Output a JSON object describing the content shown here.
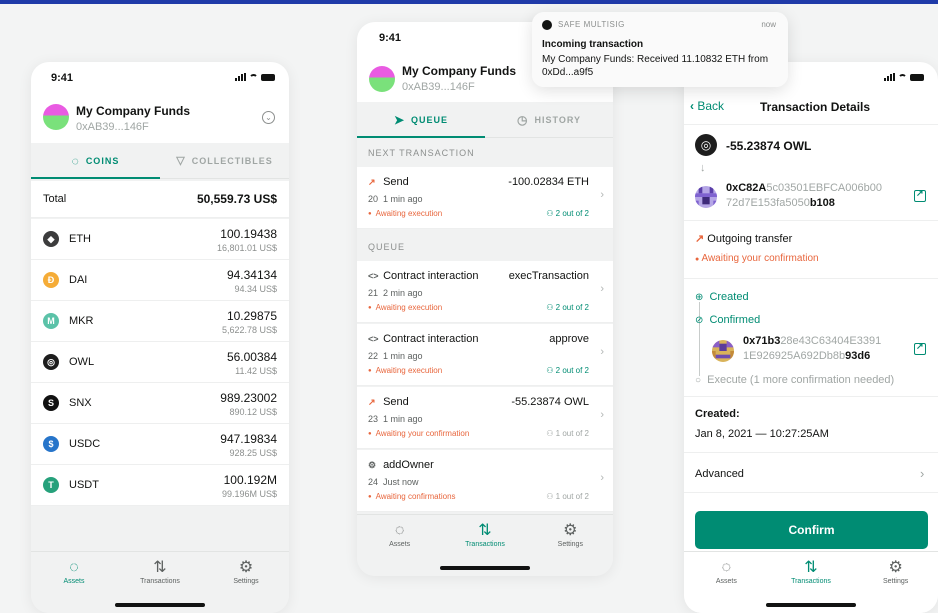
{
  "colors": {
    "primary": "#008c73",
    "warning": "#e8663d",
    "text": "#121312",
    "muted": "#a0a6a4"
  },
  "phone1": {
    "time": "9:41",
    "safe_name": "My Company Funds",
    "safe_address": "0xAB39...146F",
    "tabs": {
      "coins": "COINS",
      "collectibles": "COLLECTIBLES"
    },
    "total_label": "Total",
    "total_value": "50,559.73 US$",
    "coins": [
      {
        "symbol": "ETH",
        "balance": "100.19438",
        "fiat": "16,801.01 US$",
        "icon": "ethereum-icon",
        "color": "#3c3c3d",
        "glyph": "◆"
      },
      {
        "symbol": "DAI",
        "balance": "94.34134",
        "fiat": "94.34 US$",
        "icon": "dai-icon",
        "color": "#f5ac37",
        "glyph": "Ð"
      },
      {
        "symbol": "MKR",
        "balance": "10.29875",
        "fiat": "5,622.78 US$",
        "icon": "maker-icon",
        "color": "#5bc2a8",
        "glyph": "M"
      },
      {
        "symbol": "OWL",
        "balance": "56.00384",
        "fiat": "11.42 US$",
        "icon": "owl-icon",
        "color": "#1d1d1d",
        "glyph": "◎"
      },
      {
        "symbol": "SNX",
        "balance": "989.23002",
        "fiat": "890.12 US$",
        "icon": "synthetix-icon",
        "color": "#111111",
        "glyph": "S"
      },
      {
        "symbol": "USDC",
        "balance": "947.19834",
        "fiat": "928.25 US$",
        "icon": "usdc-icon",
        "color": "#2775ca",
        "glyph": "$"
      },
      {
        "symbol": "USDT",
        "balance": "100.192M",
        "fiat": "99.196M US$",
        "icon": "tether-icon",
        "color": "#26a17b",
        "glyph": "T"
      }
    ]
  },
  "nav": {
    "assets": "Assets",
    "transactions": "Transactions",
    "settings": "Settings"
  },
  "phone2": {
    "time": "9:41",
    "safe_name": "My Company Funds",
    "safe_address": "0xAB39...146F",
    "tabs": {
      "queue": "QUEUE",
      "history": "HISTORY"
    },
    "next_label": "NEXT TRANSACTION",
    "queue_label": "QUEUE",
    "next": {
      "title": "Send",
      "value": "-100.02834 ETH",
      "nonce": "20",
      "time": "1 min ago",
      "status": "Awaiting execution",
      "confirmations": "2 out of 2",
      "icon": "send"
    },
    "queue": [
      {
        "title": "Contract interaction",
        "value": "execTransaction",
        "nonce": "21",
        "time": "2 min ago",
        "status": "Awaiting execution",
        "confirmations": "2 out of 2",
        "icon": "code",
        "complete": true
      },
      {
        "title": "Contract interaction",
        "value": "approve",
        "nonce": "22",
        "time": "1 min ago",
        "status": "Awaiting execution",
        "confirmations": "2 out of 2",
        "icon": "code",
        "complete": true
      },
      {
        "title": "Send",
        "value": "-55.23874 OWL",
        "nonce": "23",
        "time": "1 min ago",
        "status": "Awaiting your confirmation",
        "confirmations": "1 out of 2",
        "icon": "send",
        "complete": false
      },
      {
        "title": "addOwner",
        "value": "",
        "nonce": "24",
        "time": "Just now",
        "status": "Awaiting confirmations",
        "confirmations": "1 out of 2",
        "icon": "gear",
        "complete": false
      }
    ]
  },
  "notification": {
    "app": "SAFE MULTISIG",
    "time": "now",
    "title": "Incoming transaction",
    "body": "My Company Funds: Received 11.10832 ETH from 0xDd...a9f5"
  },
  "phone3": {
    "back": "Back",
    "title": "Transaction Details",
    "amount": "-55.23874 OWL",
    "recipient_bold1": "0xC82A",
    "recipient_mid": "5c03501EBFCA006b00",
    "recipient_line2": "72d7E153fa5050",
    "recipient_bold2": "b108",
    "transfer_type": "Outgoing transfer",
    "status": "Awaiting your confirmation",
    "created_step": "Created",
    "confirmed_step": "Confirmed",
    "signer_bold1": "0x71b3",
    "signer_mid": "28e43C63404E3391",
    "signer_line2": "1E926925A692Db8b",
    "signer_bold2": "93d6",
    "execute_step": "Execute (1 more confirmation needed)",
    "created_label": "Created:",
    "created_date": "Jan 8, 2021 — 10:27:25AM",
    "advanced": "Advanced",
    "confirm": "Confirm"
  }
}
